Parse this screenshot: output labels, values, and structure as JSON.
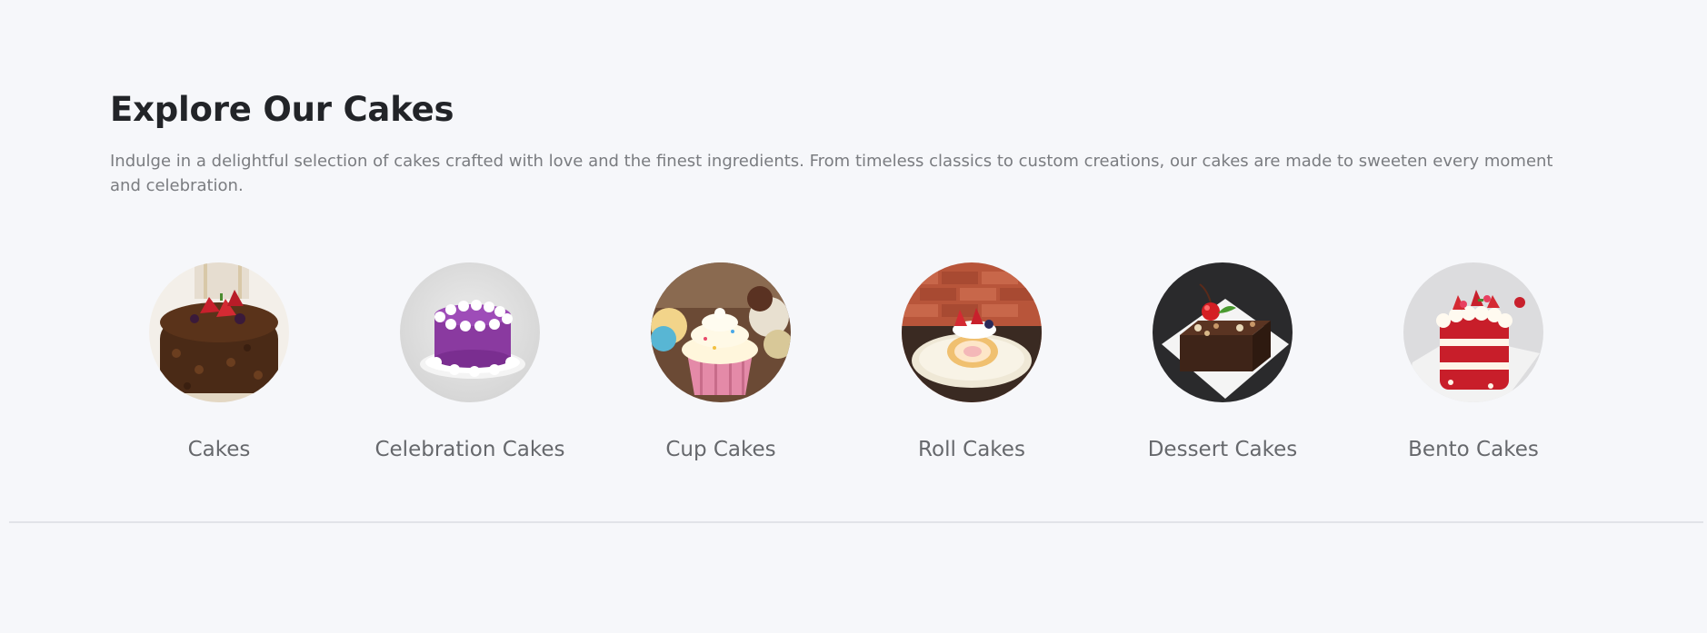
{
  "page": {
    "background": "#f6f7fa"
  },
  "explore": {
    "title": "Explore Our Cakes",
    "description": "Indulge in a delightful selection of cakes crafted with love and the finest ingredients. From timeless classics to custom creations, our cakes are made to sweeten every moment and celebration."
  },
  "categories": [
    {
      "label": "Cakes",
      "image": "chocolate-cake-image"
    },
    {
      "label": "Celebration Cakes",
      "image": "purple-celebration-cake-image"
    },
    {
      "label": "Cup Cakes",
      "image": "cupcake-image"
    },
    {
      "label": "Roll Cakes",
      "image": "roll-cake-image"
    },
    {
      "label": "Dessert Cakes",
      "image": "brownie-dessert-image"
    },
    {
      "label": "Bento Cakes",
      "image": "red-velvet-bento-cake-image"
    }
  ]
}
